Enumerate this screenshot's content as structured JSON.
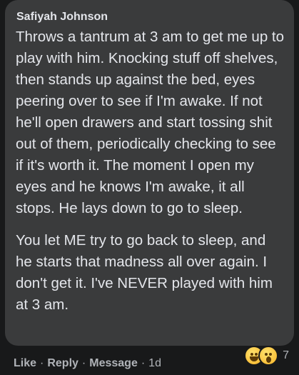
{
  "comment": {
    "author": "Safiyah Johnson",
    "paragraphs": [
      "Throws a tantrum at 3 am to get me up to play with him. Knocking stuff off shelves, then stands up against the bed, eyes peering over to see if I'm awake. If not he'll open drawers and start tossing shit out of them, periodically checking to see if it's worth it. The moment I open my eyes and he knows I'm awake, it all stops. He lays down to go to sleep.",
      "You let ME try to go back to sleep, and he starts that madness all over again. I don't get it. I've NEVER played with him at 3 am."
    ]
  },
  "actions": {
    "like": "Like",
    "reply": "Reply",
    "message": "Message",
    "time": "1d",
    "separator": "·"
  },
  "reactions": {
    "icons": [
      "haha-emoji-icon",
      "wow-emoji-icon"
    ],
    "count": "7"
  }
}
